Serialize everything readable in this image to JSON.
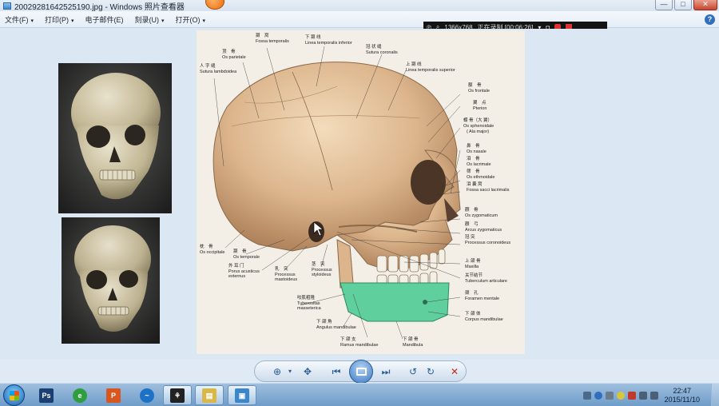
{
  "window": {
    "title": "20029281642525190.jpg - Windows 照片查看器",
    "badge": "",
    "buttons": {
      "minimize": "—",
      "maximize": "□",
      "close": "✕"
    }
  },
  "menu": {
    "items": [
      {
        "label": "文件(F)"
      },
      {
        "label": "打印(P)"
      },
      {
        "label": "电子邮件(E)"
      },
      {
        "label": "刻录(U)"
      },
      {
        "label": "打开(O)"
      }
    ],
    "help": "?"
  },
  "recorder": {
    "resolution": "1366x768",
    "status": "正在录制 [00:06:26]"
  },
  "plate_labels": [
    {
      "text": "颞　窝",
      "sub": "Fossa temporalis"
    },
    {
      "text": "下 颞 线",
      "sub": "Linea temporalis inferior"
    },
    {
      "text": "冠 状 缝",
      "sub": "Sutura coronalis"
    },
    {
      "text": "顶　骨",
      "sub": "Os parietale"
    },
    {
      "text": "人 字 缝",
      "sub": "Sutura lambdoidea"
    },
    {
      "text": "上 颞 线",
      "sub": "Linea temporalis superior"
    },
    {
      "text": "额　骨",
      "sub": "Os frontale"
    },
    {
      "text": "翼　点",
      "sub": "Pterion"
    },
    {
      "text": "蝶 骨（大 翼）",
      "sub": "Os sphenoidale"
    },
    {
      "text": "",
      "sub": "( Ala major)"
    },
    {
      "text": "鼻　骨",
      "sub": "Os nasale"
    },
    {
      "text": "泪　骨",
      "sub": "Os lacrimale"
    },
    {
      "text": "筛　骨",
      "sub": "Os ethmoidale"
    },
    {
      "text": "泪 囊 窝",
      "sub": "Fossa sacci lacrimalis"
    },
    {
      "text": "颧　骨",
      "sub": "Os zygomaticum"
    },
    {
      "text": "颧　弓",
      "sub": "Arcus zygomaticus"
    },
    {
      "text": "冠 突",
      "sub": "Processus coronoideus"
    },
    {
      "text": "枕　骨",
      "sub": "Os occipitale"
    },
    {
      "text": "颞　骨",
      "sub": "Os temporale"
    },
    {
      "text": "外 耳 门",
      "sub": "Porus acusticus externus"
    },
    {
      "text": "乳　突",
      "sub": "Processus mastoideus"
    },
    {
      "text": "茎　突",
      "sub": "Processus styloideus"
    },
    {
      "text": "上 颌 骨",
      "sub": "Maxilla"
    },
    {
      "text": "关节结节",
      "sub": "Tuberculum articulare"
    },
    {
      "text": "咬肌粗隆",
      "sub": "Tuberositas masseterica"
    },
    {
      "text": "颏　孔",
      "sub": "Foramen mentale"
    },
    {
      "text": "下 颌 体",
      "sub": "Corpus mandibulae"
    },
    {
      "text": "下 颌 角",
      "sub": "Angulus mandibulae"
    },
    {
      "text": "下 颌 支",
      "sub": "Ramus mandibulae"
    },
    {
      "text": "下 颌 骨",
      "sub": "Mandibula"
    }
  ],
  "controls": {
    "zoom": "⊕",
    "fit": "✥",
    "prev": "⏮",
    "slideshow": "",
    "next": "⏭",
    "rotate_ccw": "↺",
    "rotate_cw": "↻",
    "delete": "✕"
  },
  "taskbar": {
    "apps": [
      {
        "glyph": "Ps",
        "color": "#1b3f73"
      },
      {
        "glyph": "e",
        "color": "#2f9e3f"
      },
      {
        "glyph": "P",
        "color": "#d8561f"
      },
      {
        "glyph": "~",
        "color": "#1d72c7"
      },
      {
        "glyph": "⚘",
        "color": "#222222"
      },
      {
        "glyph": "▤",
        "color": "#d9b84a"
      },
      {
        "glyph": "▣",
        "color": "#3d86c8"
      }
    ],
    "clock_time": "22:47",
    "clock_date": "2015/11/10"
  }
}
